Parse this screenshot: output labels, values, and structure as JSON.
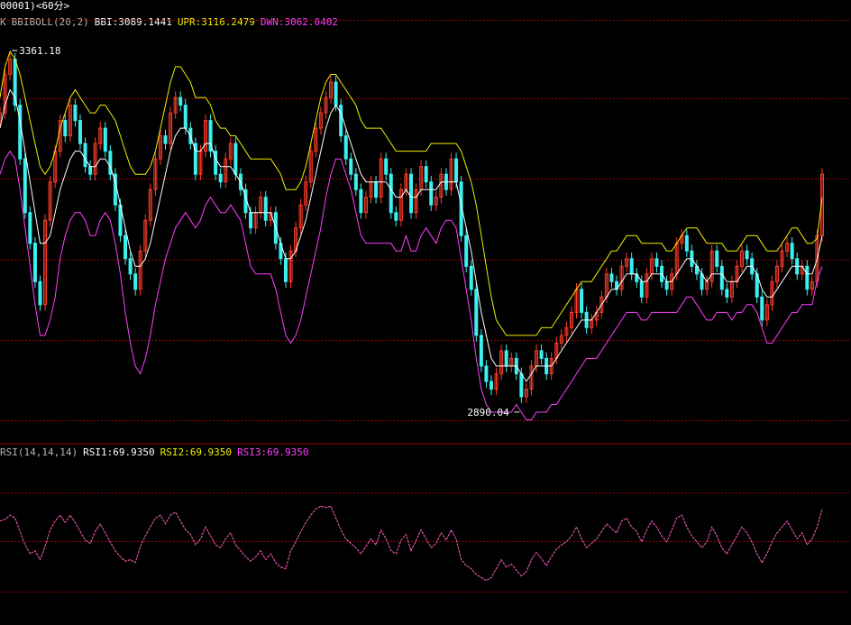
{
  "window": {
    "title": "00001)<60分>"
  },
  "main_panel": {
    "indicator_prefix": "K",
    "indicator_name": "BBIBOLL(20,2)",
    "bbi_label": "BBI:3089.1441",
    "upr_label": "UPR:3116.2479",
    "dwn_label": "DWN:3062.0402",
    "high_marker": "3361.18",
    "low_marker": "2890.04"
  },
  "rsi_panel": {
    "indicator_name": "RSI(14,14,14)",
    "rsi1_label": "RSI1:69.9350",
    "rsi2_label": "RSI2:69.9350",
    "rsi3_label": "RSI3:69.9350"
  },
  "colors": {
    "background": "#000000",
    "up_candle": "#ff3c28",
    "down_candle": "#3cf0f0",
    "bbi": "#ffffff",
    "upr": "#f0f000",
    "dwn": "#ff40ff",
    "rsi": "#ff60c0",
    "grid": "#a00000"
  },
  "chart_data": [
    {
      "type": "candlestick",
      "indicator": "BBIBOLL(20,2)",
      "ylim": [
        2870,
        3380
      ],
      "high": 3361.18,
      "low": 2890.04,
      "close": [
        3280,
        3330,
        3350,
        3290,
        3220,
        3150,
        3110,
        3060,
        3030,
        3140,
        3190,
        3230,
        3270,
        3250,
        3290,
        3270,
        3240,
        3210,
        3200,
        3240,
        3260,
        3230,
        3200,
        3160,
        3120,
        3090,
        3070,
        3050,
        3100,
        3140,
        3180,
        3220,
        3250,
        3240,
        3280,
        3300,
        3290,
        3260,
        3240,
        3200,
        3230,
        3270,
        3230,
        3200,
        3190,
        3220,
        3240,
        3200,
        3180,
        3150,
        3130,
        3150,
        3170,
        3140,
        3150,
        3110,
        3090,
        3060,
        3100,
        3130,
        3160,
        3190,
        3230,
        3260,
        3280,
        3300,
        3320,
        3290,
        3250,
        3220,
        3200,
        3180,
        3150,
        3170,
        3190,
        3170,
        3220,
        3200,
        3150,
        3140,
        3180,
        3200,
        3150,
        3180,
        3210,
        3190,
        3160,
        3170,
        3200,
        3180,
        3220,
        3190,
        3120,
        3080,
        3050,
        2990,
        2950,
        2930,
        2920,
        2940,
        2970,
        2950,
        2960,
        2940,
        2910,
        2920,
        2950,
        2970,
        2960,
        2940,
        2960,
        2980,
        2990,
        3000,
        3020,
        3050,
        3020,
        3000,
        3010,
        3020,
        3040,
        3070,
        3060,
        3050,
        3080,
        3090,
        3070,
        3060,
        3040,
        3070,
        3090,
        3080,
        3060,
        3050,
        3070,
        3110,
        3120,
        3100,
        3080,
        3070,
        3050,
        3060,
        3100,
        3080,
        3050,
        3040,
        3060,
        3080,
        3100,
        3090,
        3070,
        3040,
        3010,
        3030,
        3060,
        3080,
        3100,
        3110,
        3090,
        3070,
        3080,
        3050,
        3060,
        3120,
        3200
      ],
      "bbi": [
        3260,
        3290,
        3310,
        3300,
        3270,
        3230,
        3190,
        3150,
        3110,
        3110,
        3120,
        3150,
        3180,
        3200,
        3220,
        3230,
        3230,
        3220,
        3210,
        3210,
        3220,
        3220,
        3210,
        3190,
        3160,
        3130,
        3100,
        3080,
        3080,
        3090,
        3110,
        3140,
        3170,
        3200,
        3230,
        3250,
        3260,
        3260,
        3250,
        3230,
        3230,
        3240,
        3240,
        3220,
        3210,
        3210,
        3210,
        3200,
        3190,
        3170,
        3150,
        3150,
        3150,
        3150,
        3150,
        3130,
        3110,
        3090,
        3090,
        3100,
        3120,
        3140,
        3170,
        3200,
        3230,
        3260,
        3280,
        3290,
        3280,
        3260,
        3240,
        3220,
        3200,
        3190,
        3190,
        3190,
        3190,
        3190,
        3180,
        3170,
        3170,
        3180,
        3170,
        3170,
        3180,
        3180,
        3180,
        3180,
        3190,
        3190,
        3190,
        3190,
        3160,
        3130,
        3100,
        3060,
        3020,
        2990,
        2960,
        2950,
        2950,
        2950,
        2950,
        2950,
        2940,
        2930,
        2940,
        2950,
        2950,
        2950,
        2950,
        2960,
        2970,
        2980,
        2990,
        3000,
        3010,
        3010,
        3010,
        3020,
        3030,
        3040,
        3050,
        3050,
        3060,
        3070,
        3070,
        3070,
        3060,
        3060,
        3070,
        3070,
        3070,
        3060,
        3060,
        3070,
        3080,
        3090,
        3090,
        3080,
        3070,
        3060,
        3070,
        3070,
        3070,
        3060,
        3060,
        3060,
        3070,
        3080,
        3080,
        3070,
        3050,
        3040,
        3040,
        3050,
        3060,
        3070,
        3080,
        3080,
        3080,
        3070,
        3070,
        3089.1441,
        3120
      ],
      "upr": [
        3300,
        3340,
        3360,
        3350,
        3330,
        3300,
        3270,
        3240,
        3210,
        3200,
        3210,
        3230,
        3260,
        3280,
        3300,
        3310,
        3300,
        3290,
        3280,
        3280,
        3290,
        3290,
        3280,
        3270,
        3250,
        3230,
        3210,
        3200,
        3200,
        3200,
        3210,
        3230,
        3260,
        3290,
        3320,
        3340,
        3340,
        3330,
        3320,
        3300,
        3300,
        3300,
        3290,
        3270,
        3260,
        3260,
        3250,
        3250,
        3240,
        3230,
        3220,
        3220,
        3220,
        3220,
        3220,
        3210,
        3200,
        3180,
        3180,
        3180,
        3190,
        3210,
        3240,
        3270,
        3300,
        3320,
        3330,
        3330,
        3320,
        3310,
        3300,
        3290,
        3270,
        3260,
        3260,
        3260,
        3260,
        3250,
        3240,
        3230,
        3230,
        3230,
        3230,
        3230,
        3230,
        3230,
        3240,
        3240,
        3240,
        3240,
        3240,
        3240,
        3230,
        3210,
        3190,
        3160,
        3120,
        3080,
        3040,
        3010,
        3000,
        2990,
        2990,
        2990,
        2990,
        2990,
        2990,
        2990,
        3000,
        3000,
        3000,
        3010,
        3020,
        3030,
        3040,
        3050,
        3060,
        3060,
        3060,
        3070,
        3080,
        3090,
        3100,
        3100,
        3110,
        3120,
        3120,
        3120,
        3110,
        3110,
        3110,
        3110,
        3110,
        3100,
        3100,
        3110,
        3120,
        3130,
        3130,
        3130,
        3120,
        3110,
        3110,
        3110,
        3110,
        3100,
        3100,
        3100,
        3110,
        3120,
        3120,
        3120,
        3110,
        3100,
        3100,
        3100,
        3110,
        3120,
        3130,
        3130,
        3120,
        3110,
        3110,
        3116.2479,
        3170
      ],
      "dwn": [
        3200,
        3220,
        3230,
        3220,
        3180,
        3130,
        3080,
        3030,
        2990,
        2990,
        3010,
        3040,
        3090,
        3120,
        3140,
        3150,
        3150,
        3140,
        3120,
        3120,
        3140,
        3150,
        3140,
        3110,
        3070,
        3020,
        2980,
        2950,
        2940,
        2960,
        2990,
        3030,
        3060,
        3090,
        3110,
        3130,
        3140,
        3150,
        3140,
        3130,
        3140,
        3160,
        3170,
        3160,
        3150,
        3150,
        3160,
        3150,
        3140,
        3110,
        3080,
        3070,
        3070,
        3070,
        3070,
        3050,
        3020,
        2990,
        2980,
        2990,
        3010,
        3040,
        3070,
        3100,
        3130,
        3170,
        3200,
        3220,
        3220,
        3200,
        3180,
        3150,
        3120,
        3110,
        3110,
        3110,
        3110,
        3110,
        3110,
        3100,
        3100,
        3120,
        3100,
        3100,
        3120,
        3130,
        3120,
        3110,
        3130,
        3140,
        3140,
        3130,
        3090,
        3050,
        3010,
        2960,
        2920,
        2900,
        2890,
        2890,
        2890,
        2890,
        2890,
        2900,
        2890,
        2880,
        2880,
        2890,
        2890,
        2890,
        2900,
        2900,
        2910,
        2920,
        2930,
        2940,
        2950,
        2960,
        2960,
        2960,
        2970,
        2980,
        2990,
        3000,
        3010,
        3020,
        3020,
        3020,
        3010,
        3010,
        3020,
        3020,
        3020,
        3020,
        3020,
        3020,
        3030,
        3040,
        3040,
        3030,
        3020,
        3010,
        3010,
        3020,
        3020,
        3020,
        3010,
        3020,
        3020,
        3030,
        3030,
        3020,
        3000,
        2980,
        2980,
        2990,
        3000,
        3010,
        3020,
        3020,
        3030,
        3030,
        3030,
        3062.0402,
        3080
      ]
    },
    {
      "type": "line",
      "indicator": "RSI(14,14,14)",
      "ylim": [
        0,
        100
      ],
      "rsi": [
        62,
        63,
        66,
        64,
        55,
        46,
        40,
        42,
        36,
        45,
        56,
        62,
        66,
        61,
        66,
        61,
        55,
        49,
        47,
        55,
        60,
        54,
        48,
        42,
        38,
        35,
        36,
        34,
        45,
        52,
        58,
        64,
        66,
        60,
        66,
        68,
        62,
        56,
        53,
        46,
        50,
        58,
        52,
        46,
        44,
        50,
        54,
        46,
        42,
        38,
        35,
        38,
        42,
        36,
        40,
        34,
        31,
        30,
        42,
        48,
        55,
        61,
        66,
        70,
        72,
        71,
        72,
        64,
        56,
        50,
        47,
        44,
        40,
        45,
        50,
        46,
        56,
        50,
        42,
        40,
        49,
        53,
        42,
        49,
        56,
        50,
        44,
        47,
        54,
        49,
        56,
        50,
        36,
        32,
        30,
        26,
        24,
        22,
        24,
        30,
        36,
        31,
        33,
        29,
        25,
        28,
        36,
        41,
        37,
        32,
        38,
        43,
        46,
        48,
        52,
        58,
        50,
        44,
        47,
        50,
        55,
        60,
        57,
        54,
        62,
        64,
        58,
        55,
        48,
        56,
        62,
        58,
        52,
        48,
        56,
        64,
        66,
        58,
        52,
        48,
        44,
        48,
        58,
        52,
        44,
        40,
        46,
        52,
        58,
        54,
        48,
        40,
        34,
        40,
        48,
        54,
        58,
        62,
        56,
        50,
        54,
        46,
        50,
        58,
        69.935
      ]
    }
  ]
}
